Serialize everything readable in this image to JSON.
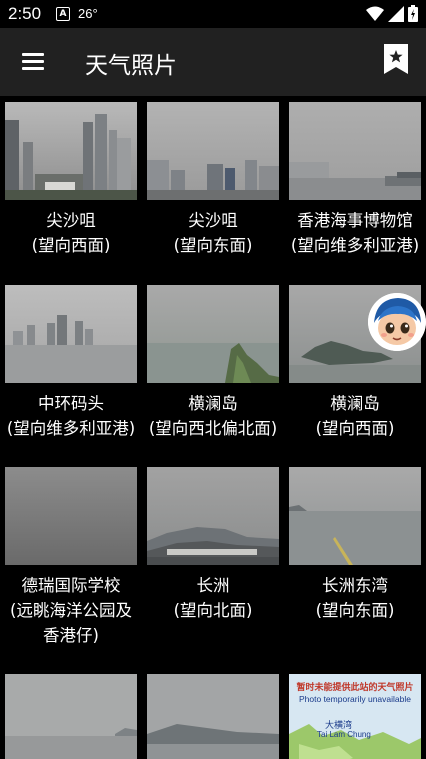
{
  "status": {
    "time": "2:50",
    "temp": "26°"
  },
  "appbar": {
    "title": "天气照片"
  },
  "photos": [
    {
      "line1": "尖沙咀",
      "line2": "(望向西面)",
      "line3": ""
    },
    {
      "line1": "尖沙咀",
      "line2": "(望向东面)",
      "line3": ""
    },
    {
      "line1": "香港海事博物馆",
      "line2": "(望向维多利亚港)",
      "line3": ""
    },
    {
      "line1": "中环码头",
      "line2": "(望向维多利亚港)",
      "line3": ""
    },
    {
      "line1": "横澜岛",
      "line2": "(望向西北偏北面)",
      "line3": ""
    },
    {
      "line1": "横澜岛",
      "line2": "(望向西面)",
      "line3": ""
    },
    {
      "line1": "德瑞国际学校",
      "line2": "(远眺海洋公园及",
      "line3": "香港仔)"
    },
    {
      "line1": "长洲",
      "line2": "(望向北面)",
      "line3": ""
    },
    {
      "line1": "长洲东湾",
      "line2": "(望向东面)",
      "line3": ""
    }
  ],
  "unavailable": {
    "line1": "暂时未能提供此站的天气照片",
    "line2": "Photo temporarily unavailable",
    "label_cn": "大横湾",
    "label_en": "Tai Lam Chung"
  }
}
